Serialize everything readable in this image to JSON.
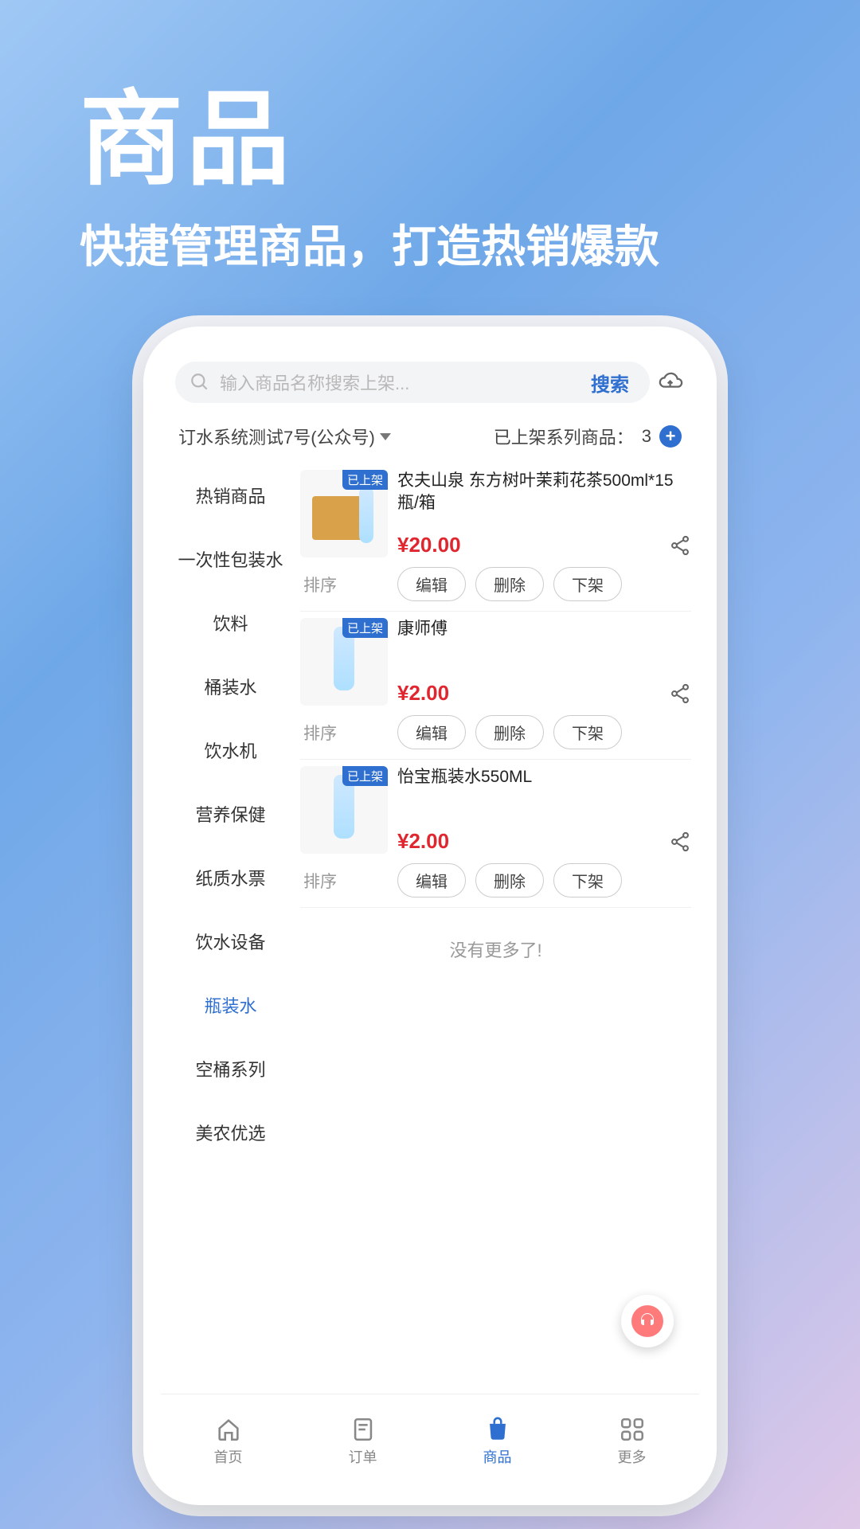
{
  "hero": {
    "title": "商品",
    "subtitle": "快捷管理商品，打造热销爆款"
  },
  "search": {
    "placeholder": "输入商品名称搜索上架...",
    "button": "搜索"
  },
  "subheader": {
    "dropdown": "订水系统测试7号(公众号)",
    "count_label": "已上架系列商品：",
    "count": "3"
  },
  "categories": [
    {
      "label": "热销商品",
      "active": false
    },
    {
      "label": "一次性包装水",
      "active": false
    },
    {
      "label": "饮料",
      "active": false
    },
    {
      "label": "桶装水",
      "active": false
    },
    {
      "label": "饮水机",
      "active": false
    },
    {
      "label": "营养保健",
      "active": false
    },
    {
      "label": "纸质水票",
      "active": false
    },
    {
      "label": "饮水设备",
      "active": false
    },
    {
      "label": "瓶装水",
      "active": true
    },
    {
      "label": "空桶系列",
      "active": false
    },
    {
      "label": "美农优选",
      "active": false
    }
  ],
  "products": [
    {
      "badge": "已上架",
      "name": "农夫山泉 东方树叶茉莉花茶500ml*15瓶/箱",
      "price": "¥20.00"
    },
    {
      "badge": "已上架",
      "name": "康师傅",
      "price": "¥2.00"
    },
    {
      "badge": "已上架",
      "name": "怡宝瓶装水550ML",
      "price": "¥2.00"
    }
  ],
  "actions": {
    "sort": "排序",
    "edit": "编辑",
    "delete": "删除",
    "unshelf": "下架"
  },
  "no_more": "没有更多了!",
  "nav": [
    {
      "label": "首页",
      "icon": "home",
      "active": false
    },
    {
      "label": "订单",
      "icon": "order",
      "active": false
    },
    {
      "label": "商品",
      "icon": "product",
      "active": true
    },
    {
      "label": "更多",
      "icon": "more",
      "active": false
    }
  ]
}
